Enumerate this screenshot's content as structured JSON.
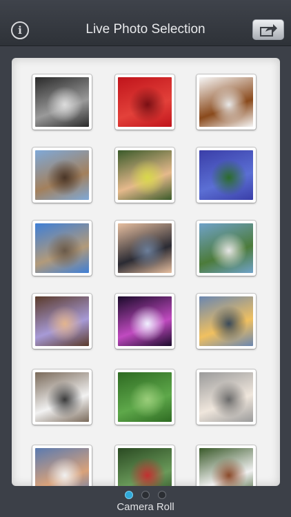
{
  "header": {
    "title": "Live Photo Selection",
    "info_icon": "info-icon",
    "share_icon": "share-arrow-icon"
  },
  "photos": [
    {
      "subject": "man-with-cup",
      "colors": [
        "#2a2a2a",
        "#9a9a9a",
        "#dcdcdc"
      ]
    },
    {
      "subject": "strawberries",
      "colors": [
        "#c0141b",
        "#e3413a",
        "#7a0f14"
      ]
    },
    {
      "subject": "puppy",
      "colors": [
        "#f6f6f6",
        "#8a4a1c",
        "#e8e8e8"
      ]
    },
    {
      "subject": "city-skyline",
      "colors": [
        "#7fa9d8",
        "#a3805c",
        "#4a3628"
      ]
    },
    {
      "subject": "child-with-bubbles",
      "colors": [
        "#3a5a2a",
        "#e5b98c",
        "#d7d84a"
      ]
    },
    {
      "subject": "blue-flowers",
      "colors": [
        "#3a3ea8",
        "#5b6fd4",
        "#2b6b2b"
      ]
    },
    {
      "subject": "mountain-canyon",
      "colors": [
        "#3f7fd6",
        "#b29a7a",
        "#6a5a4a"
      ]
    },
    {
      "subject": "island-sunset",
      "colors": [
        "#e7bfa0",
        "#2b2b33",
        "#6d7f9a"
      ]
    },
    {
      "subject": "waterfall-hiker",
      "colors": [
        "#6fa2c9",
        "#4c7b3a",
        "#e6e6e6"
      ]
    },
    {
      "subject": "laughing-child",
      "colors": [
        "#5a3a2a",
        "#a79ad6",
        "#e2b48e"
      ]
    },
    {
      "subject": "concert-stage",
      "colors": [
        "#1a0a2a",
        "#c04ac0",
        "#f0f0ff"
      ]
    },
    {
      "subject": "beach-sunset",
      "colors": [
        "#6a86b0",
        "#f0c060",
        "#3a4a5a"
      ]
    },
    {
      "subject": "cats-playing",
      "colors": [
        "#7a6a5a",
        "#f2f2f2",
        "#3a3a3a"
      ]
    },
    {
      "subject": "green-leaves",
      "colors": [
        "#2e6a22",
        "#5ea84a",
        "#9acd7a"
      ]
    },
    {
      "subject": "white-kitten",
      "colors": [
        "#9a9a9a",
        "#efe6dc",
        "#6a6a6a"
      ]
    },
    {
      "subject": "couple-selfie",
      "colors": [
        "#5a7ab0",
        "#d9a27a",
        "#f0f0f0"
      ]
    },
    {
      "subject": "plant-leaves",
      "colors": [
        "#2a4a22",
        "#6a9a5a",
        "#c23030"
      ]
    },
    {
      "subject": "toy-figures",
      "colors": [
        "#3a5a2a",
        "#f0f0f0",
        "#8a4a2a"
      ]
    }
  ],
  "footer": {
    "page_dots": 3,
    "active_page": 1,
    "caption": "Camera Roll"
  }
}
